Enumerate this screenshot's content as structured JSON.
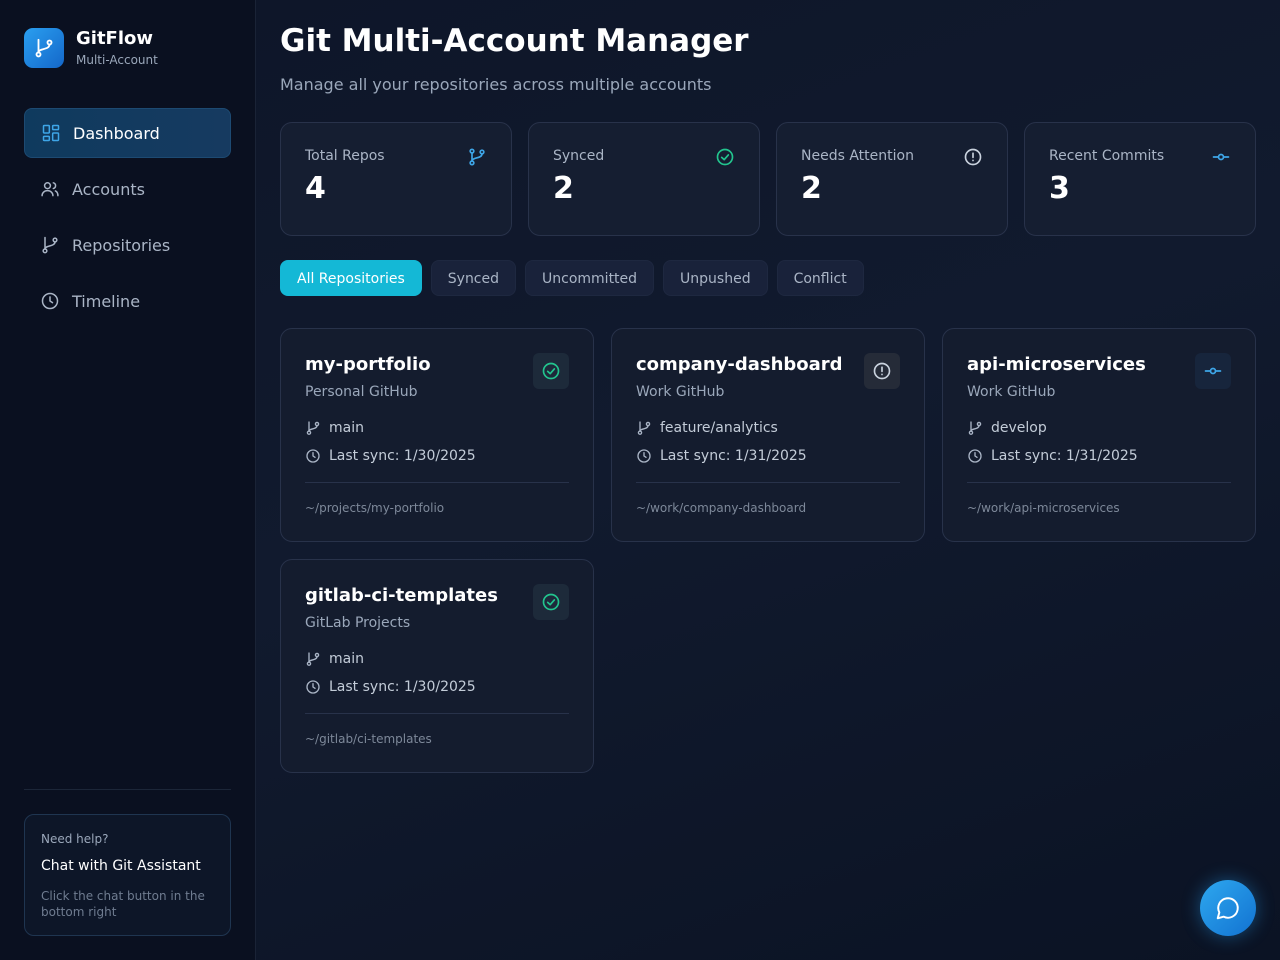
{
  "brand": {
    "name": "GitFlow",
    "subtitle": "Multi-Account"
  },
  "nav": {
    "items": [
      {
        "label": "Dashboard",
        "icon": "grid-icon",
        "active": true
      },
      {
        "label": "Accounts",
        "icon": "users-icon",
        "active": false
      },
      {
        "label": "Repositories",
        "icon": "git-branch-icon",
        "active": false
      },
      {
        "label": "Timeline",
        "icon": "clock-icon",
        "active": false
      }
    ]
  },
  "help": {
    "title": "Need help?",
    "link": "Chat with Git Assistant",
    "description": "Click the chat button in the bottom right"
  },
  "header": {
    "title": "Git Multi-Account Manager",
    "subtitle": "Manage all your repositories across multiple accounts"
  },
  "stats": [
    {
      "label": "Total Repos",
      "value": "4",
      "icon": "git-branch-icon",
      "color": "#3ea6e8"
    },
    {
      "label": "Synced",
      "value": "2",
      "icon": "check-circle-icon",
      "color": "#22c58e"
    },
    {
      "label": "Needs Attention",
      "value": "2",
      "icon": "alert-circle-icon",
      "color": "#c9d2de"
    },
    {
      "label": "Recent Commits",
      "value": "3",
      "icon": "git-commit-icon",
      "color": "#3ea6e8"
    }
  ],
  "filters": [
    {
      "label": "All Repositories",
      "active": true
    },
    {
      "label": "Synced",
      "active": false
    },
    {
      "label": "Uncommitted",
      "active": false
    },
    {
      "label": "Unpushed",
      "active": false
    },
    {
      "label": "Conflict",
      "active": false
    }
  ],
  "repos": [
    {
      "name": "my-portfolio",
      "account": "Personal GitHub",
      "branch": "main",
      "last_sync": "Last sync: 1/30/2025",
      "path": "~/projects/my-portfolio",
      "status": "check-circle-icon"
    },
    {
      "name": "company-dashboard",
      "account": "Work GitHub",
      "branch": "feature/analytics",
      "last_sync": "Last sync: 1/31/2025",
      "path": "~/work/company-dashboard",
      "status": "alert-circle-icon"
    },
    {
      "name": "api-microservices",
      "account": "Work GitHub",
      "branch": "develop",
      "last_sync": "Last sync: 1/31/2025",
      "path": "~/work/api-microservices",
      "status": "git-commit-icon"
    },
    {
      "name": "gitlab-ci-templates",
      "account": "GitLab Projects",
      "branch": "main",
      "last_sync": "Last sync: 1/30/2025",
      "path": "~/gitlab/ci-templates",
      "status": "check-circle-icon"
    }
  ],
  "colors": {
    "accent": "#14b8d6",
    "synced": "#22c58e",
    "info": "#3ea6e8"
  }
}
